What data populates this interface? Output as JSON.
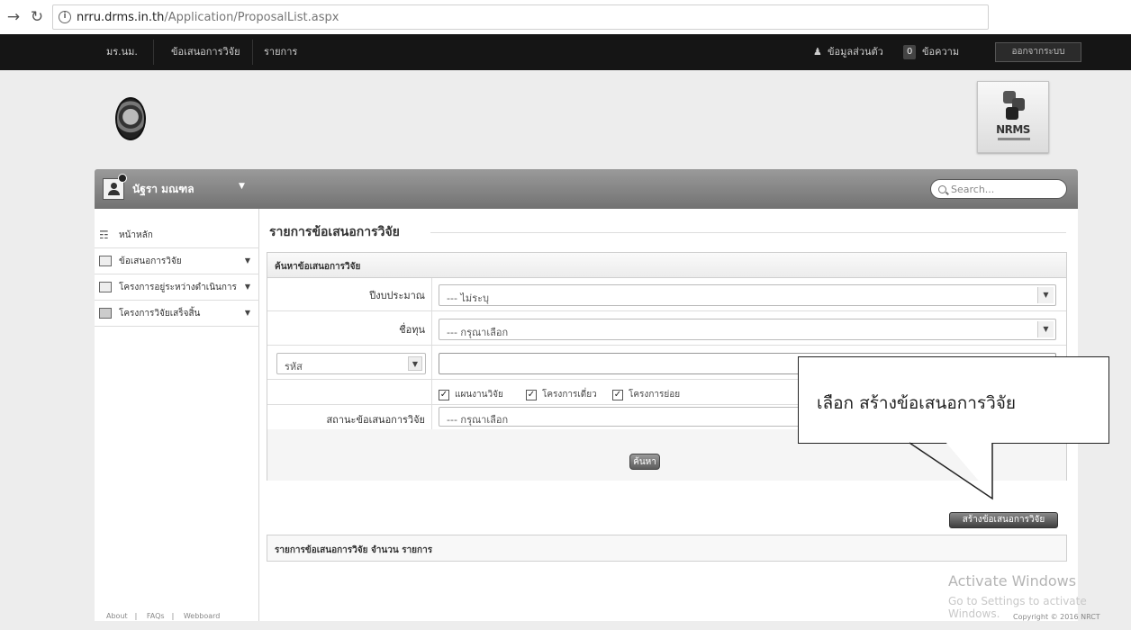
{
  "browser": {
    "url_host": "nrru.drms.in.th",
    "url_path": "/Application/ProposalList.aspx"
  },
  "topnav": {
    "items": [
      "มร.นม.",
      "ข้อเสนอการวิจัย",
      "รายการ"
    ],
    "profile_label": "ข้อมูลส่วนตัว",
    "message_count": "0",
    "message_label": "ข้อความ",
    "logout_label": "ออกจากระบบ"
  },
  "logo": {
    "nrms": "NRMS"
  },
  "userbar": {
    "user_name": "นัฐรา มณฑล",
    "search_placeholder": "Search..."
  },
  "sidebar": {
    "items": [
      {
        "label": "หน้าหลัก"
      },
      {
        "label": "ข้อเสนอการวิจัย"
      },
      {
        "label": "โครงการอยู่ระหว่างดำเนินการ"
      },
      {
        "label": "โครงการวิจัยเสร็จสิ้น"
      }
    ]
  },
  "main": {
    "page_title": "รายการข้อเสนอการวิจัย",
    "search_panel_title": "ค้นหาข้อเสนอการวิจัย",
    "fiscal_year_label": "ปีงบประมาณ",
    "fiscal_year_value": "--- ไม่ระบุ",
    "fund_label": "ชื่อทุน",
    "fund_value": "--- กรุณาเลือก",
    "code_select_value": "รหัส",
    "checkboxes": [
      {
        "label": "แผนงานวิจัย"
      },
      {
        "label": "โครงการเดี่ยว"
      },
      {
        "label": "โครงการย่อย"
      }
    ],
    "status_label": "สถานะข้อเสนอการวิจัย",
    "status_value": "--- กรุณาเลือก",
    "search_button": "ค้นหา",
    "create_button": "สร้างข้อเสนอการวิจัย",
    "list_title": "รายการข้อเสนอการวิจัย จำนวน รายการ"
  },
  "callout": {
    "text": "เลือก สร้างข้อเสนอการวิจัย"
  },
  "footer": {
    "links": [
      "About",
      "FAQs",
      "Webboard"
    ],
    "copyright": "Copyright © 2016 NRCT"
  },
  "watermark": {
    "line1": "Activate Windows",
    "line2": "Go to Settings to activate Windows."
  }
}
